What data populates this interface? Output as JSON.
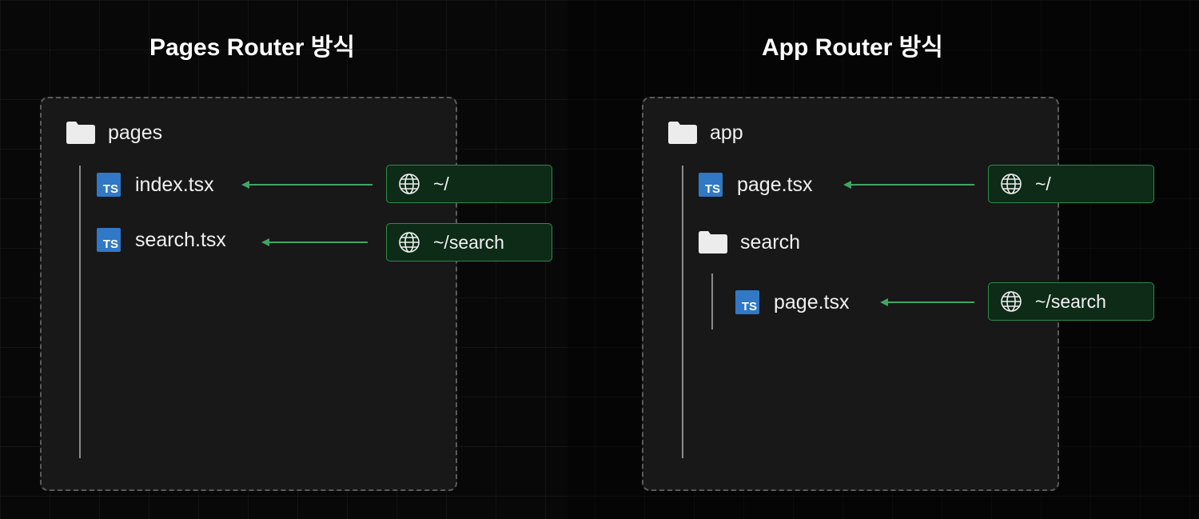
{
  "left": {
    "title": "Pages Router 방식",
    "folder": "pages",
    "files": [
      {
        "name": "index.tsx",
        "icon": "ts-icon",
        "route": "~/"
      },
      {
        "name": "search.tsx",
        "icon": "ts-icon",
        "route": "~/search"
      }
    ]
  },
  "right": {
    "title": "App Router 방식",
    "folder": "app",
    "file_root": {
      "name": "page.tsx",
      "icon": "ts-icon",
      "route": "~/"
    },
    "subfolder": "search",
    "file_sub": {
      "name": "page.tsx",
      "icon": "ts-icon",
      "route": "~/search"
    }
  },
  "icon_label": "TS",
  "colors": {
    "background": "#080808",
    "panel": "#181818",
    "ts_blue": "#3178c6",
    "route_border": "#2f8a4a",
    "route_fill": "#0d2b17",
    "arrow": "#3fa764"
  }
}
